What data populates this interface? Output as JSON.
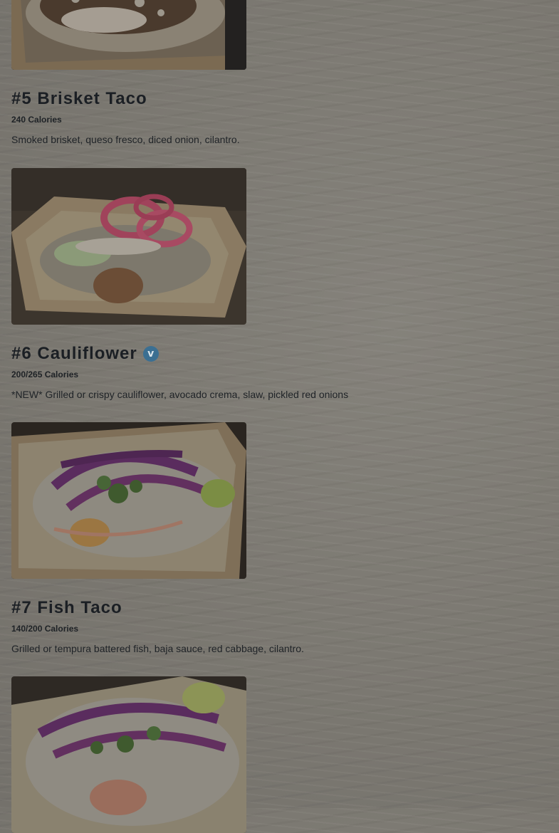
{
  "menu": {
    "items": [
      {
        "title": "#5 Brisket Taco",
        "calories": "240 Calories",
        "description": "Smoked brisket, queso fresco, diced onion, cilantro.",
        "photo_icon": "brisket-taco-photo",
        "vegetarian": false
      },
      {
        "title": "#6 Cauliflower",
        "calories": "200/265 Calories",
        "description": "*NEW* Grilled or crispy cauliflower, avocado crema, slaw, pickled red onions",
        "photo_icon": "cauliflower-taco-photo",
        "vegetarian": true,
        "badge": "v"
      },
      {
        "title": "#7 Fish Taco",
        "calories": "140/200 Calories",
        "description": "Grilled or tempura battered fish, baja sauce, red cabbage, cilantro.",
        "photo_icon": "fish-taco-photo",
        "vegetarian": false
      },
      {
        "title": "",
        "calories": "",
        "description": "",
        "photo_icon": "shrimp-taco-photo",
        "vegetarian": false
      }
    ]
  },
  "colors": {
    "overlay_background": "#7e7b74",
    "title_text": "#1b1f24",
    "vegetarian_badge": "#3b6f92"
  }
}
